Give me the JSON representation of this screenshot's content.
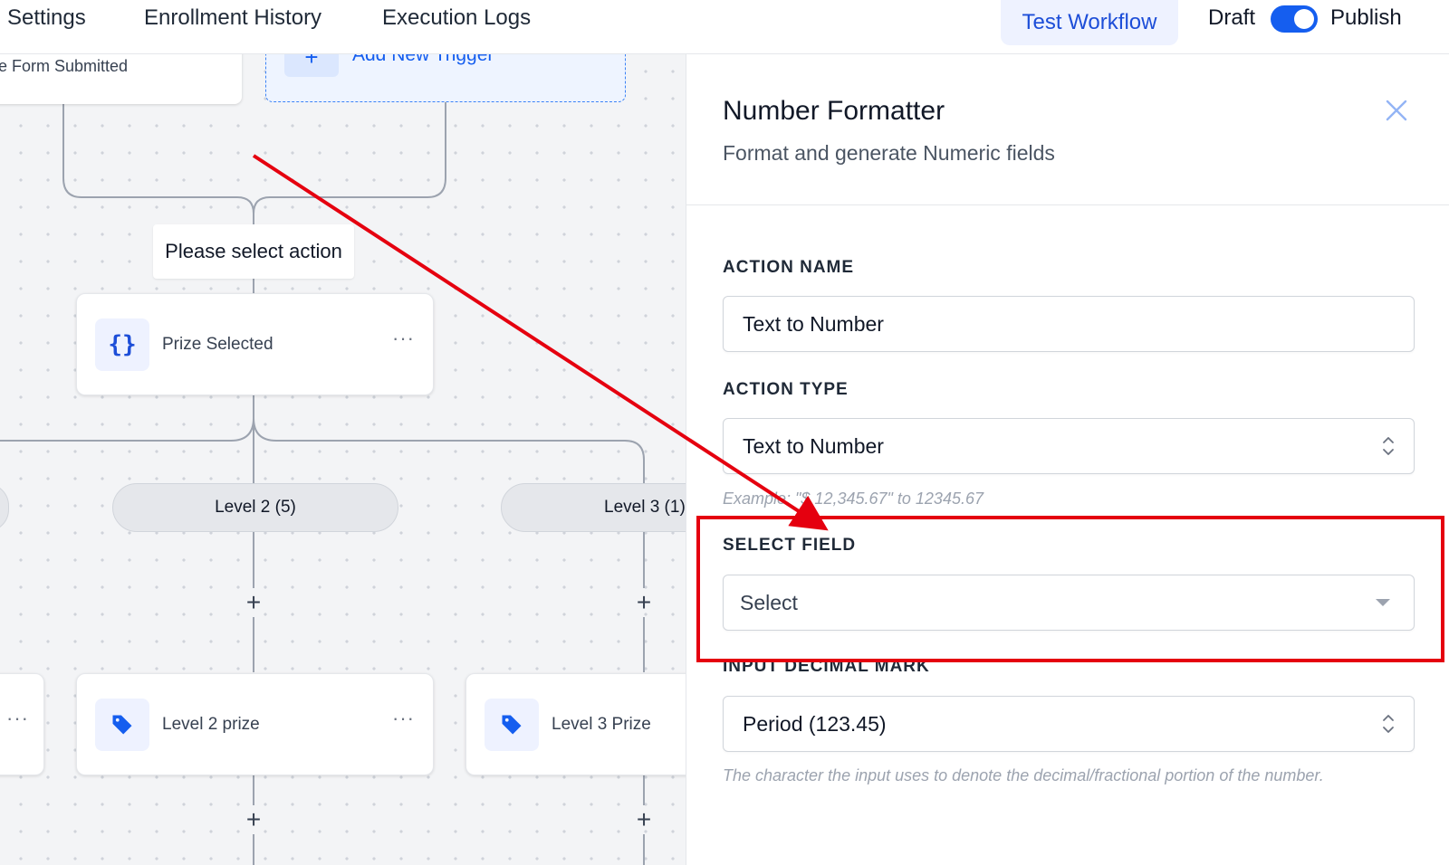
{
  "topbar": {
    "tabs": [
      "Settings",
      "Enrollment History",
      "Execution Logs"
    ],
    "test_workflow": "Test Workflow",
    "draft": "Draft",
    "publish": "Publish",
    "publish_toggle_on": true
  },
  "canvas": {
    "trigger_card": "e Form Submitted",
    "add_trigger": "Add New Trigger",
    "action_label": "Please select action",
    "prize_node": {
      "label": "Prize Selected",
      "icon": "braces-icon"
    },
    "branches": [
      {
        "label": "Level 2 (5)"
      },
      {
        "label": "Level 3 (1)"
      }
    ],
    "prize_nodes": [
      {
        "label": "Level 2 prize",
        "icon": "tag-icon"
      },
      {
        "label": "Level 3 Prize",
        "icon": "tag-icon"
      }
    ],
    "more_glyph": "···",
    "plus_glyph": "+"
  },
  "panel": {
    "title": "Number Formatter",
    "subtitle": "Format and generate Numeric fields",
    "action_name": {
      "label": "ACTION NAME",
      "value": "Text to Number"
    },
    "action_type": {
      "label": "ACTION TYPE",
      "value": "Text to Number",
      "hint": "Example: \"$ 12,345.67\" to 12345.67"
    },
    "select_field": {
      "label": "SELECT FIELD",
      "placeholder": "Select"
    },
    "decimal_mark": {
      "label": "INPUT DECIMAL MARK",
      "value": "Period (123.45)",
      "hint": "The character the input uses to denote the decimal/fractional portion of the number."
    }
  },
  "colors": {
    "accent": "#155eef",
    "annotation": "#e5000f",
    "canvas_bg": "#f3f4f6"
  }
}
